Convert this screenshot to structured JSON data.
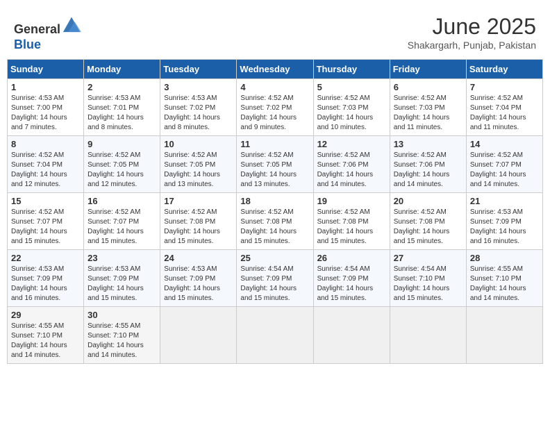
{
  "header": {
    "logo_line1": "General",
    "logo_line2": "Blue",
    "month_year": "June 2025",
    "location": "Shakargarh, Punjab, Pakistan"
  },
  "weekdays": [
    "Sunday",
    "Monday",
    "Tuesday",
    "Wednesday",
    "Thursday",
    "Friday",
    "Saturday"
  ],
  "weeks": [
    [
      {
        "day": "1",
        "sunrise": "Sunrise: 4:53 AM",
        "sunset": "Sunset: 7:00 PM",
        "daylight": "Daylight: 14 hours and 7 minutes."
      },
      {
        "day": "2",
        "sunrise": "Sunrise: 4:53 AM",
        "sunset": "Sunset: 7:01 PM",
        "daylight": "Daylight: 14 hours and 8 minutes."
      },
      {
        "day": "3",
        "sunrise": "Sunrise: 4:53 AM",
        "sunset": "Sunset: 7:02 PM",
        "daylight": "Daylight: 14 hours and 8 minutes."
      },
      {
        "day": "4",
        "sunrise": "Sunrise: 4:52 AM",
        "sunset": "Sunset: 7:02 PM",
        "daylight": "Daylight: 14 hours and 9 minutes."
      },
      {
        "day": "5",
        "sunrise": "Sunrise: 4:52 AM",
        "sunset": "Sunset: 7:03 PM",
        "daylight": "Daylight: 14 hours and 10 minutes."
      },
      {
        "day": "6",
        "sunrise": "Sunrise: 4:52 AM",
        "sunset": "Sunset: 7:03 PM",
        "daylight": "Daylight: 14 hours and 11 minutes."
      },
      {
        "day": "7",
        "sunrise": "Sunrise: 4:52 AM",
        "sunset": "Sunset: 7:04 PM",
        "daylight": "Daylight: 14 hours and 11 minutes."
      }
    ],
    [
      {
        "day": "8",
        "sunrise": "Sunrise: 4:52 AM",
        "sunset": "Sunset: 7:04 PM",
        "daylight": "Daylight: 14 hours and 12 minutes."
      },
      {
        "day": "9",
        "sunrise": "Sunrise: 4:52 AM",
        "sunset": "Sunset: 7:05 PM",
        "daylight": "Daylight: 14 hours and 12 minutes."
      },
      {
        "day": "10",
        "sunrise": "Sunrise: 4:52 AM",
        "sunset": "Sunset: 7:05 PM",
        "daylight": "Daylight: 14 hours and 13 minutes."
      },
      {
        "day": "11",
        "sunrise": "Sunrise: 4:52 AM",
        "sunset": "Sunset: 7:05 PM",
        "daylight": "Daylight: 14 hours and 13 minutes."
      },
      {
        "day": "12",
        "sunrise": "Sunrise: 4:52 AM",
        "sunset": "Sunset: 7:06 PM",
        "daylight": "Daylight: 14 hours and 14 minutes."
      },
      {
        "day": "13",
        "sunrise": "Sunrise: 4:52 AM",
        "sunset": "Sunset: 7:06 PM",
        "daylight": "Daylight: 14 hours and 14 minutes."
      },
      {
        "day": "14",
        "sunrise": "Sunrise: 4:52 AM",
        "sunset": "Sunset: 7:07 PM",
        "daylight": "Daylight: 14 hours and 14 minutes."
      }
    ],
    [
      {
        "day": "15",
        "sunrise": "Sunrise: 4:52 AM",
        "sunset": "Sunset: 7:07 PM",
        "daylight": "Daylight: 14 hours and 15 minutes."
      },
      {
        "day": "16",
        "sunrise": "Sunrise: 4:52 AM",
        "sunset": "Sunset: 7:07 PM",
        "daylight": "Daylight: 14 hours and 15 minutes."
      },
      {
        "day": "17",
        "sunrise": "Sunrise: 4:52 AM",
        "sunset": "Sunset: 7:08 PM",
        "daylight": "Daylight: 14 hours and 15 minutes."
      },
      {
        "day": "18",
        "sunrise": "Sunrise: 4:52 AM",
        "sunset": "Sunset: 7:08 PM",
        "daylight": "Daylight: 14 hours and 15 minutes."
      },
      {
        "day": "19",
        "sunrise": "Sunrise: 4:52 AM",
        "sunset": "Sunset: 7:08 PM",
        "daylight": "Daylight: 14 hours and 15 minutes."
      },
      {
        "day": "20",
        "sunrise": "Sunrise: 4:52 AM",
        "sunset": "Sunset: 7:08 PM",
        "daylight": "Daylight: 14 hours and 15 minutes."
      },
      {
        "day": "21",
        "sunrise": "Sunrise: 4:53 AM",
        "sunset": "Sunset: 7:09 PM",
        "daylight": "Daylight: 14 hours and 16 minutes."
      }
    ],
    [
      {
        "day": "22",
        "sunrise": "Sunrise: 4:53 AM",
        "sunset": "Sunset: 7:09 PM",
        "daylight": "Daylight: 14 hours and 16 minutes."
      },
      {
        "day": "23",
        "sunrise": "Sunrise: 4:53 AM",
        "sunset": "Sunset: 7:09 PM",
        "daylight": "Daylight: 14 hours and 15 minutes."
      },
      {
        "day": "24",
        "sunrise": "Sunrise: 4:53 AM",
        "sunset": "Sunset: 7:09 PM",
        "daylight": "Daylight: 14 hours and 15 minutes."
      },
      {
        "day": "25",
        "sunrise": "Sunrise: 4:54 AM",
        "sunset": "Sunset: 7:09 PM",
        "daylight": "Daylight: 14 hours and 15 minutes."
      },
      {
        "day": "26",
        "sunrise": "Sunrise: 4:54 AM",
        "sunset": "Sunset: 7:09 PM",
        "daylight": "Daylight: 14 hours and 15 minutes."
      },
      {
        "day": "27",
        "sunrise": "Sunrise: 4:54 AM",
        "sunset": "Sunset: 7:10 PM",
        "daylight": "Daylight: 14 hours and 15 minutes."
      },
      {
        "day": "28",
        "sunrise": "Sunrise: 4:55 AM",
        "sunset": "Sunset: 7:10 PM",
        "daylight": "Daylight: 14 hours and 14 minutes."
      }
    ],
    [
      {
        "day": "29",
        "sunrise": "Sunrise: 4:55 AM",
        "sunset": "Sunset: 7:10 PM",
        "daylight": "Daylight: 14 hours and 14 minutes."
      },
      {
        "day": "30",
        "sunrise": "Sunrise: 4:55 AM",
        "sunset": "Sunset: 7:10 PM",
        "daylight": "Daylight: 14 hours and 14 minutes."
      },
      null,
      null,
      null,
      null,
      null
    ]
  ]
}
